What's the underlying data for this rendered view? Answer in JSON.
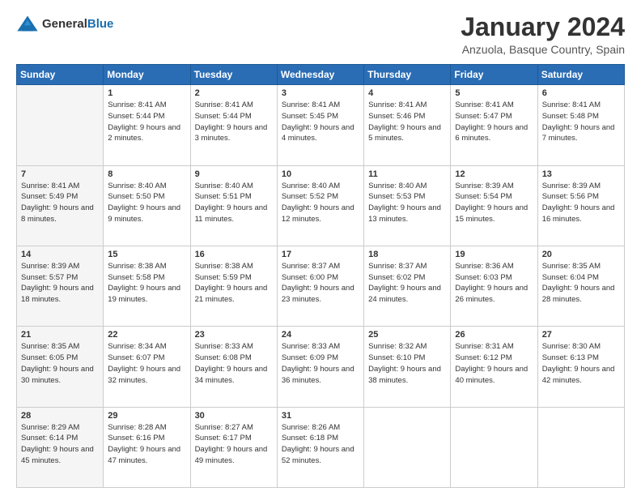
{
  "logo": {
    "general": "General",
    "blue": "Blue"
  },
  "title": "January 2024",
  "location": "Anzuola, Basque Country, Spain",
  "headers": [
    "Sunday",
    "Monday",
    "Tuesday",
    "Wednesday",
    "Thursday",
    "Friday",
    "Saturday"
  ],
  "weeks": [
    [
      {
        "day": "",
        "sunrise": "",
        "sunset": "",
        "daylight": ""
      },
      {
        "day": "1",
        "sunrise": "Sunrise: 8:41 AM",
        "sunset": "Sunset: 5:44 PM",
        "daylight": "Daylight: 9 hours and 2 minutes."
      },
      {
        "day": "2",
        "sunrise": "Sunrise: 8:41 AM",
        "sunset": "Sunset: 5:44 PM",
        "daylight": "Daylight: 9 hours and 3 minutes."
      },
      {
        "day": "3",
        "sunrise": "Sunrise: 8:41 AM",
        "sunset": "Sunset: 5:45 PM",
        "daylight": "Daylight: 9 hours and 4 minutes."
      },
      {
        "day": "4",
        "sunrise": "Sunrise: 8:41 AM",
        "sunset": "Sunset: 5:46 PM",
        "daylight": "Daylight: 9 hours and 5 minutes."
      },
      {
        "day": "5",
        "sunrise": "Sunrise: 8:41 AM",
        "sunset": "Sunset: 5:47 PM",
        "daylight": "Daylight: 9 hours and 6 minutes."
      },
      {
        "day": "6",
        "sunrise": "Sunrise: 8:41 AM",
        "sunset": "Sunset: 5:48 PM",
        "daylight": "Daylight: 9 hours and 7 minutes."
      }
    ],
    [
      {
        "day": "7",
        "sunrise": "Sunrise: 8:41 AM",
        "sunset": "Sunset: 5:49 PM",
        "daylight": "Daylight: 9 hours and 8 minutes."
      },
      {
        "day": "8",
        "sunrise": "Sunrise: 8:40 AM",
        "sunset": "Sunset: 5:50 PM",
        "daylight": "Daylight: 9 hours and 9 minutes."
      },
      {
        "day": "9",
        "sunrise": "Sunrise: 8:40 AM",
        "sunset": "Sunset: 5:51 PM",
        "daylight": "Daylight: 9 hours and 11 minutes."
      },
      {
        "day": "10",
        "sunrise": "Sunrise: 8:40 AM",
        "sunset": "Sunset: 5:52 PM",
        "daylight": "Daylight: 9 hours and 12 minutes."
      },
      {
        "day": "11",
        "sunrise": "Sunrise: 8:40 AM",
        "sunset": "Sunset: 5:53 PM",
        "daylight": "Daylight: 9 hours and 13 minutes."
      },
      {
        "day": "12",
        "sunrise": "Sunrise: 8:39 AM",
        "sunset": "Sunset: 5:54 PM",
        "daylight": "Daylight: 9 hours and 15 minutes."
      },
      {
        "day": "13",
        "sunrise": "Sunrise: 8:39 AM",
        "sunset": "Sunset: 5:56 PM",
        "daylight": "Daylight: 9 hours and 16 minutes."
      }
    ],
    [
      {
        "day": "14",
        "sunrise": "Sunrise: 8:39 AM",
        "sunset": "Sunset: 5:57 PM",
        "daylight": "Daylight: 9 hours and 18 minutes."
      },
      {
        "day": "15",
        "sunrise": "Sunrise: 8:38 AM",
        "sunset": "Sunset: 5:58 PM",
        "daylight": "Daylight: 9 hours and 19 minutes."
      },
      {
        "day": "16",
        "sunrise": "Sunrise: 8:38 AM",
        "sunset": "Sunset: 5:59 PM",
        "daylight": "Daylight: 9 hours and 21 minutes."
      },
      {
        "day": "17",
        "sunrise": "Sunrise: 8:37 AM",
        "sunset": "Sunset: 6:00 PM",
        "daylight": "Daylight: 9 hours and 23 minutes."
      },
      {
        "day": "18",
        "sunrise": "Sunrise: 8:37 AM",
        "sunset": "Sunset: 6:02 PM",
        "daylight": "Daylight: 9 hours and 24 minutes."
      },
      {
        "day": "19",
        "sunrise": "Sunrise: 8:36 AM",
        "sunset": "Sunset: 6:03 PM",
        "daylight": "Daylight: 9 hours and 26 minutes."
      },
      {
        "day": "20",
        "sunrise": "Sunrise: 8:35 AM",
        "sunset": "Sunset: 6:04 PM",
        "daylight": "Daylight: 9 hours and 28 minutes."
      }
    ],
    [
      {
        "day": "21",
        "sunrise": "Sunrise: 8:35 AM",
        "sunset": "Sunset: 6:05 PM",
        "daylight": "Daylight: 9 hours and 30 minutes."
      },
      {
        "day": "22",
        "sunrise": "Sunrise: 8:34 AM",
        "sunset": "Sunset: 6:07 PM",
        "daylight": "Daylight: 9 hours and 32 minutes."
      },
      {
        "day": "23",
        "sunrise": "Sunrise: 8:33 AM",
        "sunset": "Sunset: 6:08 PM",
        "daylight": "Daylight: 9 hours and 34 minutes."
      },
      {
        "day": "24",
        "sunrise": "Sunrise: 8:33 AM",
        "sunset": "Sunset: 6:09 PM",
        "daylight": "Daylight: 9 hours and 36 minutes."
      },
      {
        "day": "25",
        "sunrise": "Sunrise: 8:32 AM",
        "sunset": "Sunset: 6:10 PM",
        "daylight": "Daylight: 9 hours and 38 minutes."
      },
      {
        "day": "26",
        "sunrise": "Sunrise: 8:31 AM",
        "sunset": "Sunset: 6:12 PM",
        "daylight": "Daylight: 9 hours and 40 minutes."
      },
      {
        "day": "27",
        "sunrise": "Sunrise: 8:30 AM",
        "sunset": "Sunset: 6:13 PM",
        "daylight": "Daylight: 9 hours and 42 minutes."
      }
    ],
    [
      {
        "day": "28",
        "sunrise": "Sunrise: 8:29 AM",
        "sunset": "Sunset: 6:14 PM",
        "daylight": "Daylight: 9 hours and 45 minutes."
      },
      {
        "day": "29",
        "sunrise": "Sunrise: 8:28 AM",
        "sunset": "Sunset: 6:16 PM",
        "daylight": "Daylight: 9 hours and 47 minutes."
      },
      {
        "day": "30",
        "sunrise": "Sunrise: 8:27 AM",
        "sunset": "Sunset: 6:17 PM",
        "daylight": "Daylight: 9 hours and 49 minutes."
      },
      {
        "day": "31",
        "sunrise": "Sunrise: 8:26 AM",
        "sunset": "Sunset: 6:18 PM",
        "daylight": "Daylight: 9 hours and 52 minutes."
      },
      {
        "day": "",
        "sunrise": "",
        "sunset": "",
        "daylight": ""
      },
      {
        "day": "",
        "sunrise": "",
        "sunset": "",
        "daylight": ""
      },
      {
        "day": "",
        "sunrise": "",
        "sunset": "",
        "daylight": ""
      }
    ]
  ]
}
